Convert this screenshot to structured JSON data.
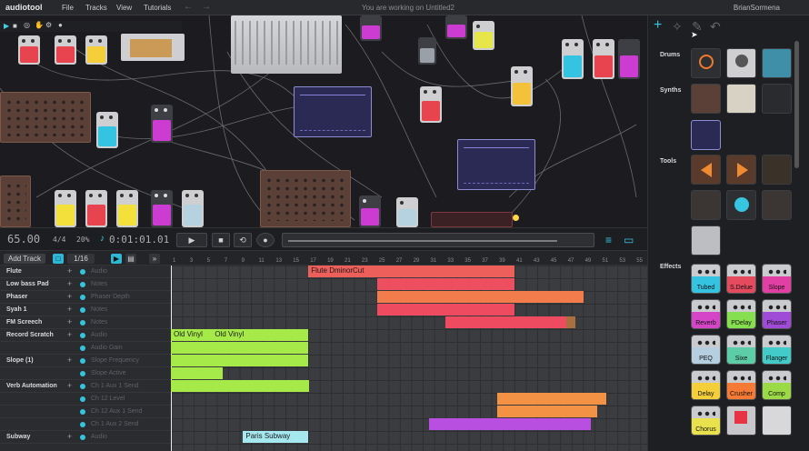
{
  "menubar": {
    "logo": "audiotool",
    "menus": [
      "File",
      "Tracks",
      "View",
      "Tutorials"
    ],
    "working": "You are working on Untitled2",
    "user": "BrianSormena"
  },
  "transport": {
    "bpm": "65.00",
    "signature": "4/4",
    "swing": "20%",
    "time": "0:01:01.01",
    "quantize": "1/16"
  },
  "sequencer": {
    "add_track": "Add Track",
    "quantize": "1/16",
    "ruler": [
      "1",
      "3",
      "5",
      "7",
      "9",
      "11",
      "13",
      "15",
      "17",
      "19",
      "21",
      "23",
      "25",
      "27",
      "29",
      "31",
      "33",
      "35",
      "37",
      "39",
      "41",
      "43",
      "45",
      "47",
      "49",
      "51",
      "53",
      "55"
    ],
    "tracks": [
      {
        "name": "Flute",
        "param": "Audio",
        "plus": true
      },
      {
        "name": "Low bass Pad",
        "param": "Notes",
        "plus": true
      },
      {
        "name": "Phaser",
        "param": "Phaser Depth",
        "plus": true
      },
      {
        "name": "Syah 1",
        "param": "Notes",
        "plus": true
      },
      {
        "name": "FM Screech",
        "param": "Notes",
        "plus": true
      },
      {
        "name": "Record Scratch",
        "param": "Audio",
        "plus": true
      },
      {
        "name": "",
        "param": "Audio Gain",
        "plus": false
      },
      {
        "name": "Slope (1)",
        "param": "Slope Frequency",
        "plus": true
      },
      {
        "name": "",
        "param": "Slope Active",
        "plus": false
      },
      {
        "name": "Verb Automation",
        "param": "Ch 1 Aux 1 Send",
        "plus": true
      },
      {
        "name": "",
        "param": "Ch 12 Level",
        "plus": false
      },
      {
        "name": "",
        "param": "Ch 12 Aux 1 Send",
        "plus": false
      },
      {
        "name": "",
        "param": "Ch 1 Aux 2 Send",
        "plus": false
      },
      {
        "name": "Subway",
        "param": "Audio",
        "plus": true
      }
    ],
    "clips": [
      {
        "row": 0,
        "start": 12,
        "len": 18,
        "color": "#ec5f5a",
        "label": "Flute DminorCut"
      },
      {
        "row": 1,
        "start": 18,
        "len": 12,
        "color": "#ee4f60",
        "label": ""
      },
      {
        "row": 2,
        "start": 18,
        "len": 18,
        "color": "#f37c4d",
        "label": ""
      },
      {
        "row": 3,
        "start": 18,
        "len": 12,
        "color": "#ee4b60",
        "label": ""
      },
      {
        "row": 4,
        "start": 24,
        "len": 10.5,
        "color": "#ee4b60",
        "label": ""
      },
      {
        "row": 4,
        "start": 34.5,
        "len": 0.8,
        "color": "#a8703e",
        "label": ""
      },
      {
        "row": 5,
        "start": 0,
        "len": 3.6,
        "color": "#a6ea4a",
        "label": "Old Vinyl"
      },
      {
        "row": 5,
        "start": 3.6,
        "len": 8.4,
        "color": "#a6ea4a",
        "label": "Old Vinyl"
      },
      {
        "row": 6,
        "start": 0,
        "len": 12,
        "color": "#a6ea4a",
        "label": ""
      },
      {
        "row": 7,
        "start": 0,
        "len": 12,
        "color": "#a6ea4a",
        "label": ""
      },
      {
        "row": 8,
        "start": 0,
        "len": 4.5,
        "color": "#a6ea4a",
        "label": ""
      },
      {
        "row": 9,
        "start": 0,
        "len": 12.1,
        "color": "#a6ea4a",
        "label": ""
      },
      {
        "row": 10,
        "start": 28.5,
        "len": 9.5,
        "color": "#f39245",
        "label": ""
      },
      {
        "row": 11,
        "start": 28.5,
        "len": 8.7,
        "color": "#f39245",
        "label": ""
      },
      {
        "row": 12,
        "start": 22.5,
        "len": 14.2,
        "color": "#b94fe0",
        "label": ""
      },
      {
        "row": 13,
        "start": 6.3,
        "len": 5.7,
        "color": "#a6e8f0",
        "label": "Paris Subway"
      }
    ]
  },
  "browser": {
    "sections": [
      "Drums",
      "Synths",
      "Tools",
      "Effects"
    ],
    "effects": [
      {
        "label": "Tubed",
        "color": "#35c3e2"
      },
      {
        "label": "S.Delue",
        "color": "#e54a5e"
      },
      {
        "label": "Slope",
        "color": "#e23fa4"
      },
      {
        "label": "Reverb",
        "color": "#d545c8"
      },
      {
        "label": "PDelay",
        "color": "#86df4e"
      },
      {
        "label": "Phaser",
        "color": "#a04ad8"
      },
      {
        "label": "PEQ",
        "color": "#b6cfe0"
      },
      {
        "label": "Sixe",
        "color": "#5ccda7"
      },
      {
        "label": "Flanger",
        "color": "#42cbc8"
      },
      {
        "label": "Delay",
        "color": "#f4cf3a"
      },
      {
        "label": "Crusher",
        "color": "#f47a35"
      },
      {
        "label": "Comp",
        "color": "#9bd947"
      },
      {
        "label": "Chorus",
        "color": "#e9e24c"
      }
    ]
  }
}
